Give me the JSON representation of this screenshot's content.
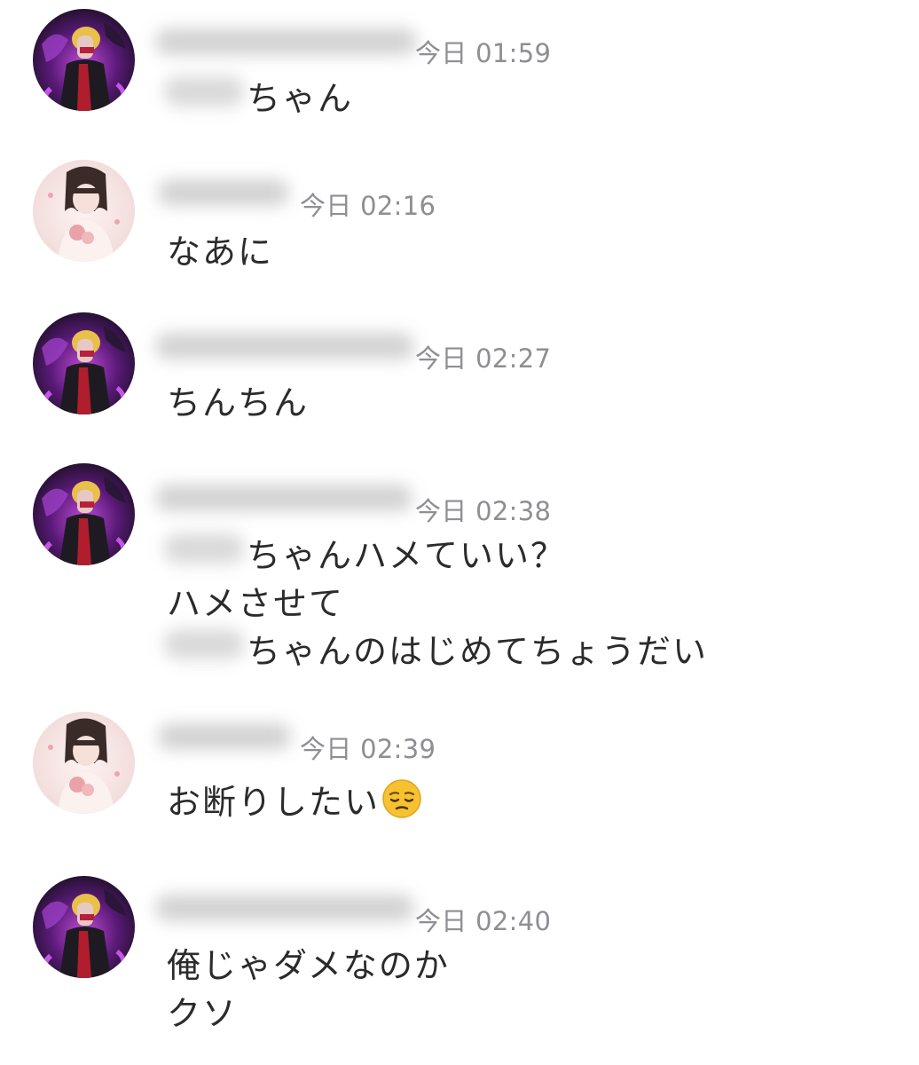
{
  "messages": [
    {
      "sender": "purple-user",
      "timestamp": "今日 01:59",
      "lines": [
        "ちゃん"
      ]
    },
    {
      "sender": "pink-user",
      "timestamp": "今日 02:16",
      "lines": [
        "なあに"
      ]
    },
    {
      "sender": "purple-user",
      "timestamp": "今日 02:27",
      "lines": [
        "ちんちん"
      ]
    },
    {
      "sender": "purple-user",
      "timestamp": "今日 02:38",
      "lines": [
        "ちゃんハメていい？",
        "ハメさせて",
        "ちゃんのはじめてちょうだい"
      ]
    },
    {
      "sender": "pink-user",
      "timestamp": "今日 02:39",
      "lines": [
        "お断りしたい"
      ],
      "emoji": "pensive-face-emoji"
    },
    {
      "sender": "purple-user",
      "timestamp": "今日 02:40",
      "lines": [
        "俺じゃダメなのか",
        "クソ"
      ]
    }
  ],
  "colors": {
    "timestamp": "#8e8e93",
    "message_text": "#2b2b2b",
    "background": "#ffffff",
    "purple_avatar_accent": "#8a2be2",
    "pink_avatar_bg": "#f7e6e6"
  }
}
